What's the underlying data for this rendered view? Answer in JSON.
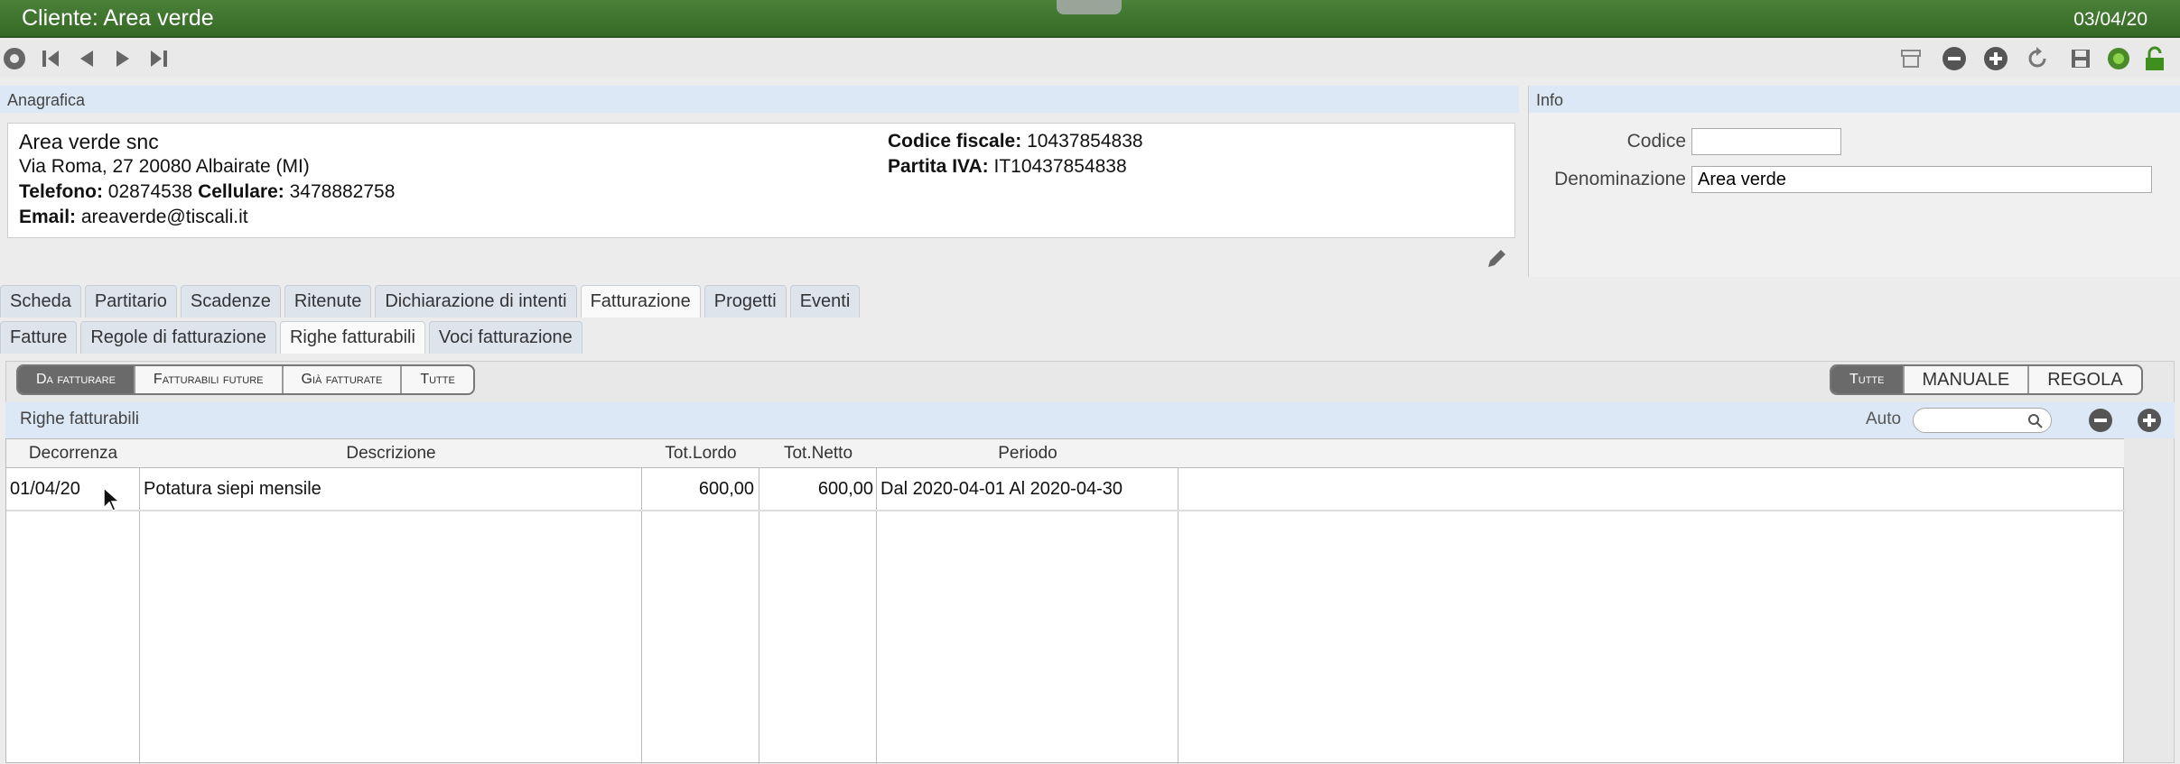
{
  "window": {
    "title": "Cliente: Area verde",
    "date": "03/04/20"
  },
  "toolbar": {
    "left_icons": [
      "circle-plus-icon",
      "first-record-icon",
      "prev-record-icon",
      "next-record-icon",
      "last-record-icon"
    ],
    "right_icons": [
      "archive-icon",
      "minus-icon",
      "plus-icon",
      "refresh-icon",
      "save-icon",
      "status-green-icon",
      "lock-icon"
    ]
  },
  "anagrafica": {
    "header": "Anagrafica",
    "name": "Area verde snc",
    "address": "Via Roma, 27 20080 Albairate (MI)",
    "telefono_label": "Telefono:",
    "telefono": "02874538",
    "cellulare_label": "Cellulare:",
    "cellulare": "3478882758",
    "email_label": "Email:",
    "email": "areaverde@tiscali.it",
    "cf_label": "Codice fiscale:",
    "cf": "10437854838",
    "piva_label": "Partita IVA:",
    "piva": "IT10437854838"
  },
  "info": {
    "header": "Info",
    "codice_label": "Codice",
    "codice_value": "",
    "denominazione_label": "Denominazione",
    "denominazione_value": "Area verde"
  },
  "tabs_main": [
    "Scheda",
    "Partitario",
    "Scadenze",
    "Ritenute",
    "Dichiarazione di intenti",
    "Fatturazione",
    "Progetti",
    "Eventi"
  ],
  "tabs_sub": [
    "Fatture",
    "Regole di fatturazione",
    "Righe fatturabili",
    "Voci fatturazione"
  ],
  "filter_left": [
    "Da fatturare",
    "Fatturabili future",
    "Già fatturate",
    "Tutte"
  ],
  "filter_right": [
    "Tutte",
    "MANUALE",
    "REGOLA"
  ],
  "righe": {
    "header": "Righe fatturabili",
    "auto_label": "Auto",
    "columns": [
      "Decorrenza",
      "Descrizione",
      "Tot.Lordo",
      "Tot.Netto",
      "Periodo"
    ],
    "rows": [
      {
        "decorrenza": "01/04/20",
        "descrizione": "Potatura siepi mensile",
        "lordo": "600,00",
        "netto": "600,00",
        "periodo": "Dal 2020-04-01 Al 2020-04-30"
      }
    ]
  }
}
